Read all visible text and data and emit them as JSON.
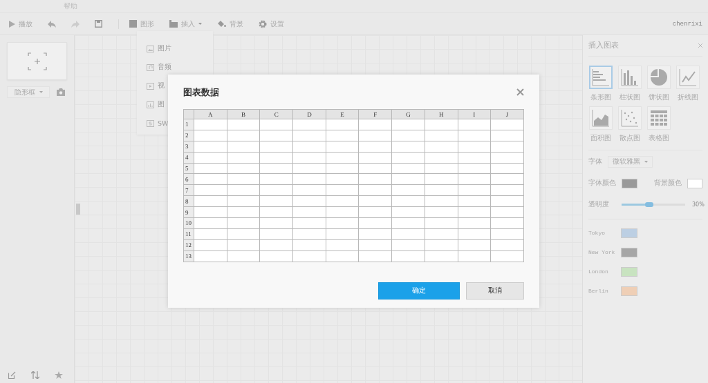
{
  "menubar": {
    "items": [
      "帮助"
    ]
  },
  "toolbar": {
    "items": [
      {
        "kind": "play",
        "label": "播放"
      },
      {
        "kind": "undo"
      },
      {
        "kind": "redo"
      },
      {
        "kind": "save"
      },
      {
        "kind": "sep"
      },
      {
        "kind": "shape",
        "label": "图形"
      },
      {
        "kind": "insert",
        "label": "插入",
        "caret": true
      },
      {
        "kind": "background",
        "label": "背景"
      },
      {
        "kind": "settings",
        "label": "设置"
      }
    ],
    "user": "chenrixi"
  },
  "insert_menu": {
    "items": [
      {
        "kind": "image",
        "label": "图片"
      },
      {
        "kind": "audio",
        "label": "音频"
      },
      {
        "kind": "video",
        "label": "视"
      },
      {
        "kind": "chart",
        "label": "图"
      },
      {
        "kind": "swf",
        "label": "SW"
      }
    ]
  },
  "left_panel": {
    "frame_select": "隐形框"
  },
  "dialog": {
    "title": "图表数据",
    "columns": [
      "A",
      "B",
      "C",
      "D",
      "E",
      "F",
      "G",
      "H",
      "I",
      "J"
    ],
    "rows": [
      "1",
      "2",
      "3",
      "4",
      "5",
      "6",
      "7",
      "8",
      "9",
      "10",
      "11",
      "12",
      "13"
    ],
    "buttons": [
      {
        "label": "确定",
        "kind": "primary"
      },
      {
        "label": "取消",
        "kind": "secondary"
      }
    ]
  },
  "right_panel": {
    "title": "插入图表",
    "chart_types": [
      {
        "kind": "bar",
        "label": "条形图",
        "selected": true
      },
      {
        "kind": "column",
        "label": "柱状图",
        "selected": false
      },
      {
        "kind": "pie",
        "label": "饼状图",
        "selected": false
      },
      {
        "kind": "line",
        "label": "折线图",
        "selected": false
      },
      {
        "kind": "area",
        "label": "面积图",
        "selected": false
      },
      {
        "kind": "scatter",
        "label": "散点图",
        "selected": false
      },
      {
        "kind": "table",
        "label": "表格图",
        "selected": false
      }
    ],
    "font_label": "字体",
    "font": "微软雅黑",
    "font_color_label": "字体颜色",
    "bg_color_label": "背景颜色",
    "opacity_label": "透明度",
    "opacity": {
      "level": 0.43,
      "reading": "30%"
    },
    "series": [
      {
        "name": "Tokyo",
        "color": "#bccfe3"
      },
      {
        "name": "New York",
        "color": "#a6a6a6"
      },
      {
        "name": "London",
        "color": "#c8e3c0"
      },
      {
        "name": "Berlin",
        "color": "#efcfb6"
      }
    ]
  }
}
